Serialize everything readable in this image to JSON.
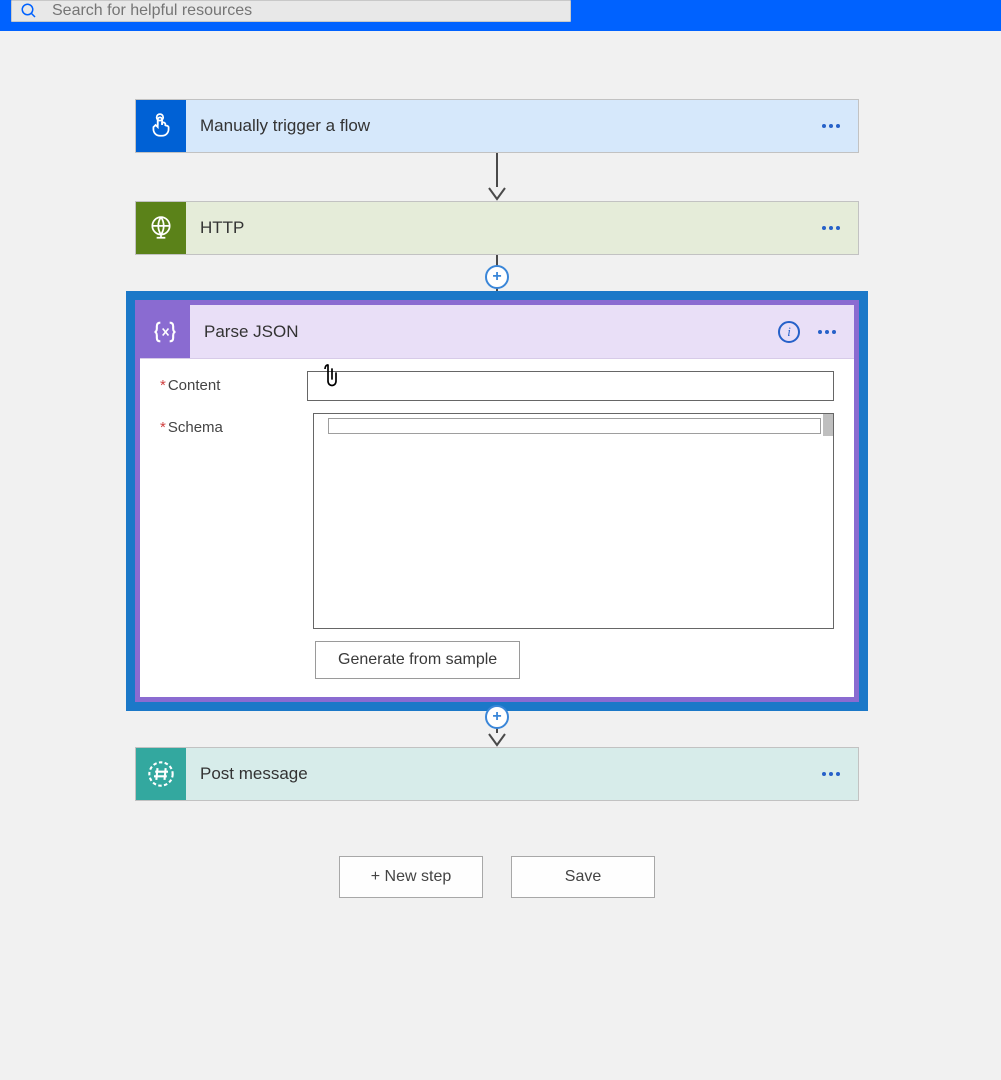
{
  "search": {
    "placeholder": "Search for helpful resources"
  },
  "steps": {
    "trigger": {
      "title": "Manually trigger a flow"
    },
    "http": {
      "title": "HTTP"
    },
    "parse": {
      "title": "Parse JSON",
      "fields": {
        "content_label": "Content",
        "schema_label": "Schema"
      },
      "generate_button": "Generate from sample"
    },
    "post": {
      "title": "Post message"
    }
  },
  "footer": {
    "new_step": "+ New step",
    "save": "Save"
  }
}
